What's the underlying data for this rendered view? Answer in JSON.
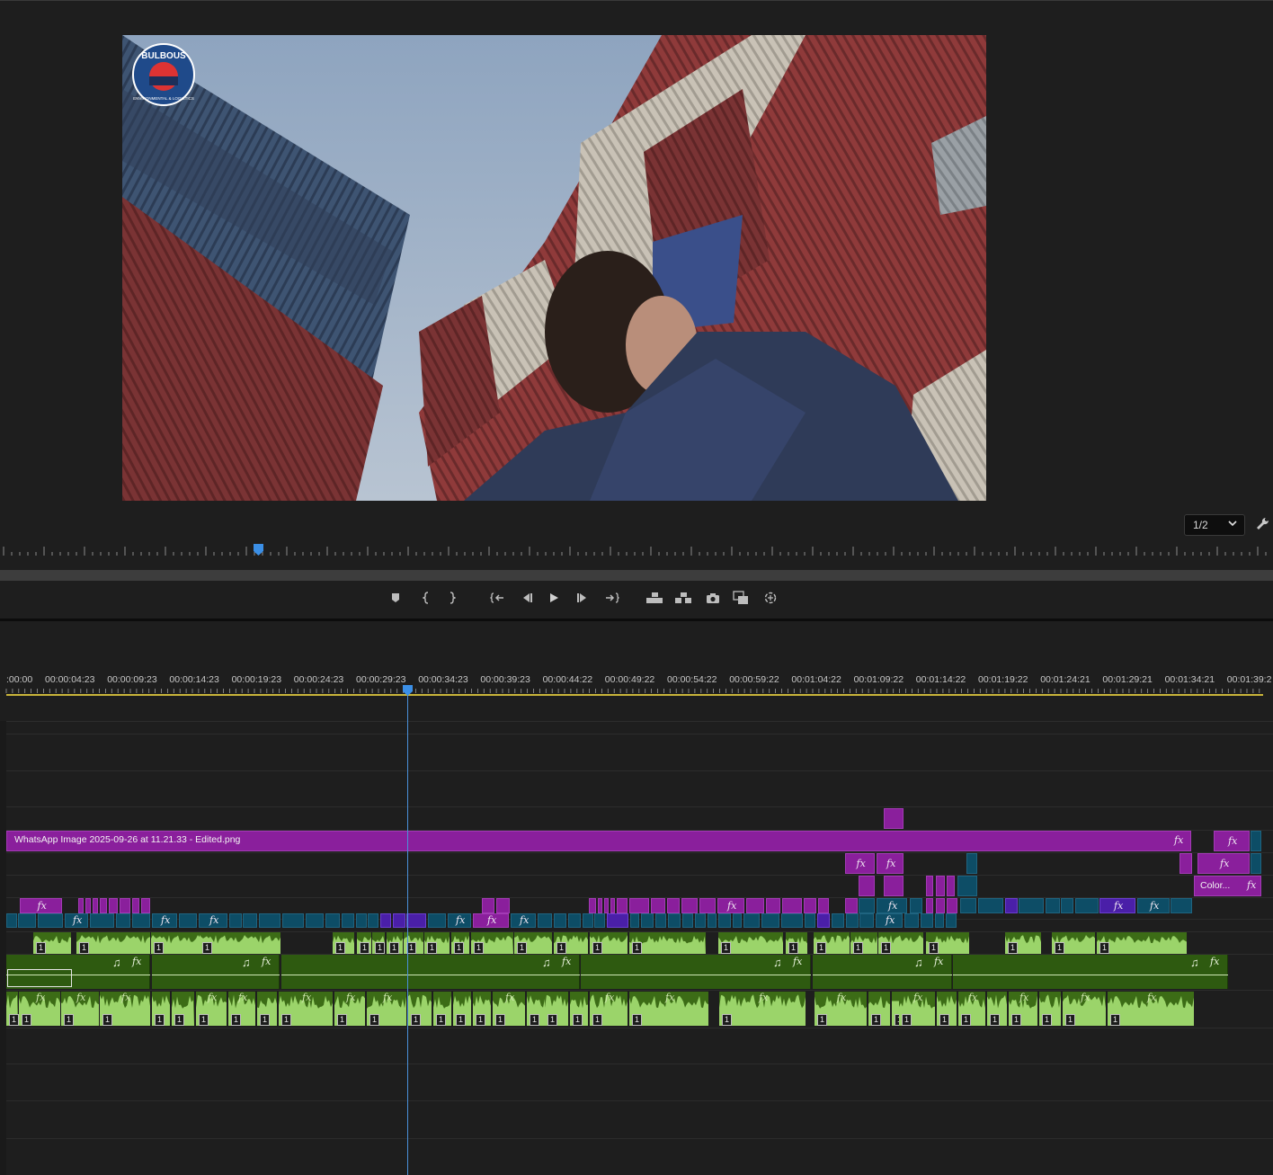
{
  "program_monitor": {
    "resolution": "1/2",
    "logo_text": [
      "BULBOUS",
      "ENVIRONMENTAL & LOGISTICS"
    ],
    "colors": {
      "playhead": "#4a90d9",
      "background": "#1e1e1e"
    }
  },
  "transport": {
    "buttons": [
      "add-marker",
      "mark-in",
      "mark-out",
      "go-to-in",
      "step-back",
      "play",
      "step-forward",
      "go-to-out",
      "lift",
      "extract",
      "export-frame",
      "comparison-view",
      "toggle-proxies"
    ]
  },
  "timeline": {
    "timecodes": [
      ":00:00",
      "00:00:04:23",
      "00:00:09:23",
      "00:00:14:23",
      "00:00:19:23",
      "00:00:24:23",
      "00:00:29:23",
      "00:00:34:23",
      "00:00:39:23",
      "00:00:44:22",
      "00:00:49:22",
      "00:00:54:22",
      "00:00:59:22",
      "00:01:04:22",
      "00:01:09:22",
      "00:01:14:22",
      "00:01:19:22",
      "00:01:24:21",
      "00:01:29:21",
      "00:01:34:21",
      "00:01:39:2"
    ],
    "clips": {
      "image_clip": "WhatsApp Image 2025-09-26 at 11.21.33 - Edited.png",
      "color_clip": "Color..."
    },
    "colors": {
      "video_purple": "#8a1f9c",
      "video_teal": "#0d4d66",
      "video_violet": "#4a1fa8",
      "audio_green": "#3c6c16",
      "waveform": "#9bd46a",
      "work_area": "#c9b43a"
    },
    "fx_label": "fx",
    "channel_label": "1",
    "music_icon": "♫"
  }
}
